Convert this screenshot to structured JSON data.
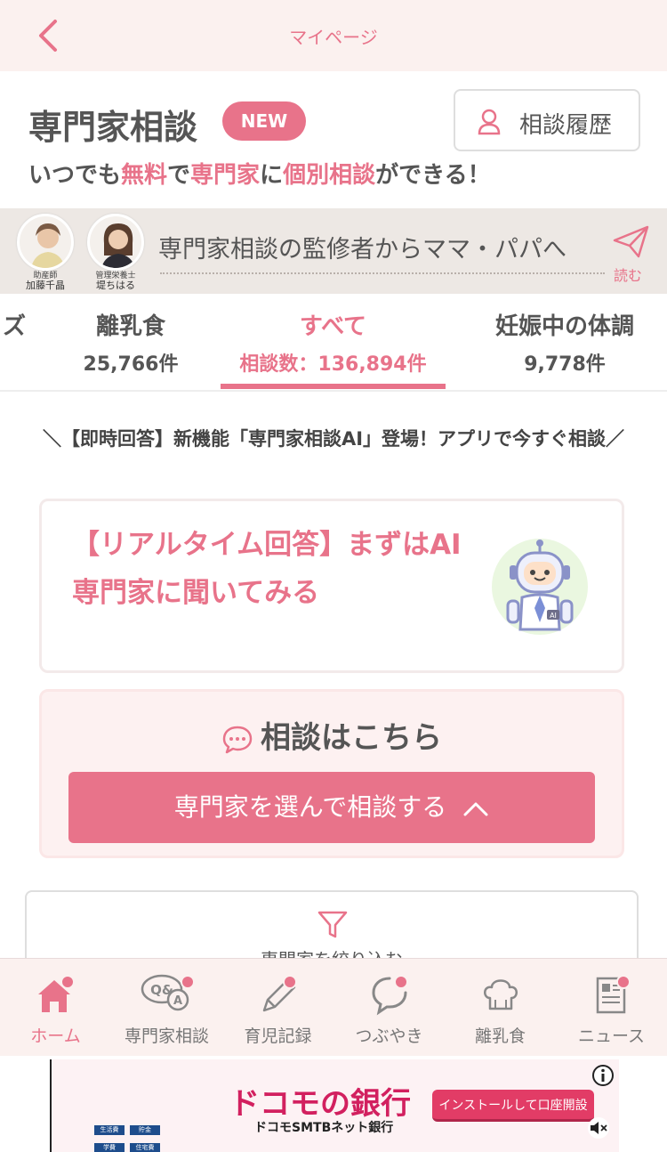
{
  "header": {
    "title": "マイページ"
  },
  "page": {
    "title": "専門家相談",
    "badge": "NEW",
    "history_label": "相談履歴",
    "subtitle": {
      "p1": "いつでも",
      "h1": "無料",
      "p2": "で",
      "h2": "専門家",
      "p3": "に",
      "h3": "個別相談",
      "p4": "ができる！"
    }
  },
  "banner": {
    "experts": [
      {
        "role": "助産師",
        "name": "加藤千晶"
      },
      {
        "role": "管理栄養士",
        "name": "堤ちはる"
      }
    ],
    "text": "専門家相談の監修者からママ・パパへ",
    "read": "読む"
  },
  "tabs": [
    {
      "name": "ズ",
      "count": ""
    },
    {
      "name": "離乳食",
      "count": "25,766件"
    },
    {
      "name": "すべて",
      "count": "相談数：136,894件",
      "active": true
    },
    {
      "name": "妊娠中の体調",
      "count": "9,778件"
    }
  ],
  "announcement": "＼【即時回答】新機能「専門家相談AI」登場！アプリで今すぐ相談／",
  "ai_card": {
    "text": "【リアルタイム回答】まずはAI専門家に聞いてみる"
  },
  "consult": {
    "heading": "相談はこちら",
    "button": "専門家を選んで相談する"
  },
  "filter": {
    "label": "専門家を絞り込む"
  },
  "bottom_nav": [
    {
      "label": "ホーム",
      "icon": "home-icon",
      "active": true,
      "badge": true
    },
    {
      "label": "専門家相談",
      "icon": "qa-icon",
      "badge": true
    },
    {
      "label": "育児記録",
      "icon": "pencil-icon",
      "badge": true
    },
    {
      "label": "つぶやき",
      "icon": "chat-bubble-icon",
      "badge": true
    },
    {
      "label": "離乳食",
      "icon": "chef-hat-icon",
      "badge": false
    },
    {
      "label": "ニュース",
      "icon": "news-icon",
      "badge": true
    }
  ],
  "ad": {
    "brand": "ドコモの銀行",
    "sub": "ドコモSMTBネット銀行",
    "cta": "インストールして口座開設",
    "tags": [
      "生活費",
      "貯金",
      "学費",
      "住宅費"
    ]
  },
  "colors": {
    "accent": "#e8738a",
    "header_bg": "#fbf1ef",
    "text": "#555555"
  }
}
